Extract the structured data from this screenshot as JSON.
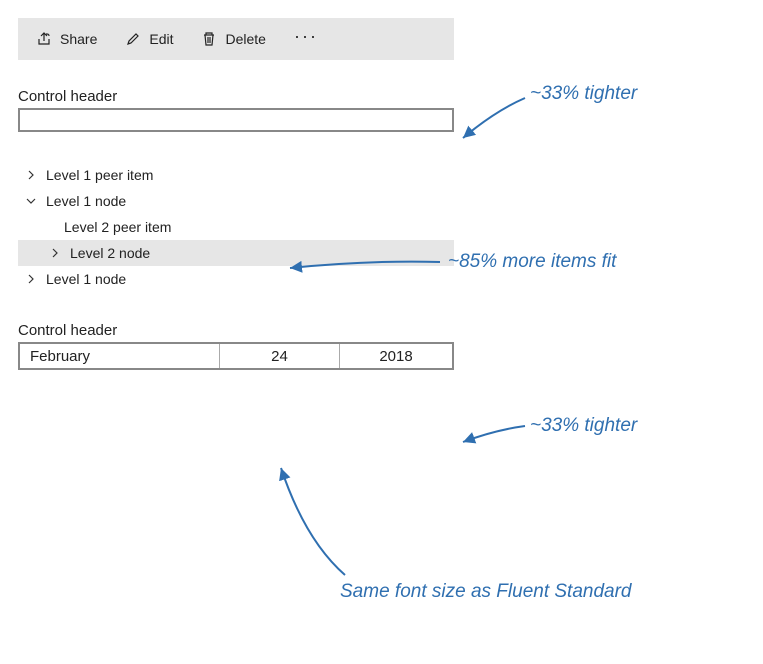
{
  "toolbar": {
    "share_label": "Share",
    "edit_label": "Edit",
    "delete_label": "Delete",
    "overflow_label": "···"
  },
  "textbox": {
    "header": "Control header",
    "value": ""
  },
  "tree": {
    "items": [
      {
        "label": "Level 1 peer item",
        "chev": "right",
        "indent": 1
      },
      {
        "label": "Level 1 node",
        "chev": "down",
        "indent": 1
      },
      {
        "label": "Level 2 peer item",
        "chev": "",
        "indent": 2
      },
      {
        "label": "Level 2 node",
        "chev": "right",
        "indent": 2,
        "selected": true
      },
      {
        "label": "Level 1 node",
        "chev": "right",
        "indent": 1
      }
    ]
  },
  "datepicker": {
    "header": "Control header",
    "month": "February",
    "day": "24",
    "year": "2018"
  },
  "annotations": {
    "a1": "~33% tighter",
    "a2": "~85% more items fit",
    "a3": "~33% tighter",
    "a4": "Same font size as Fluent Standard"
  }
}
